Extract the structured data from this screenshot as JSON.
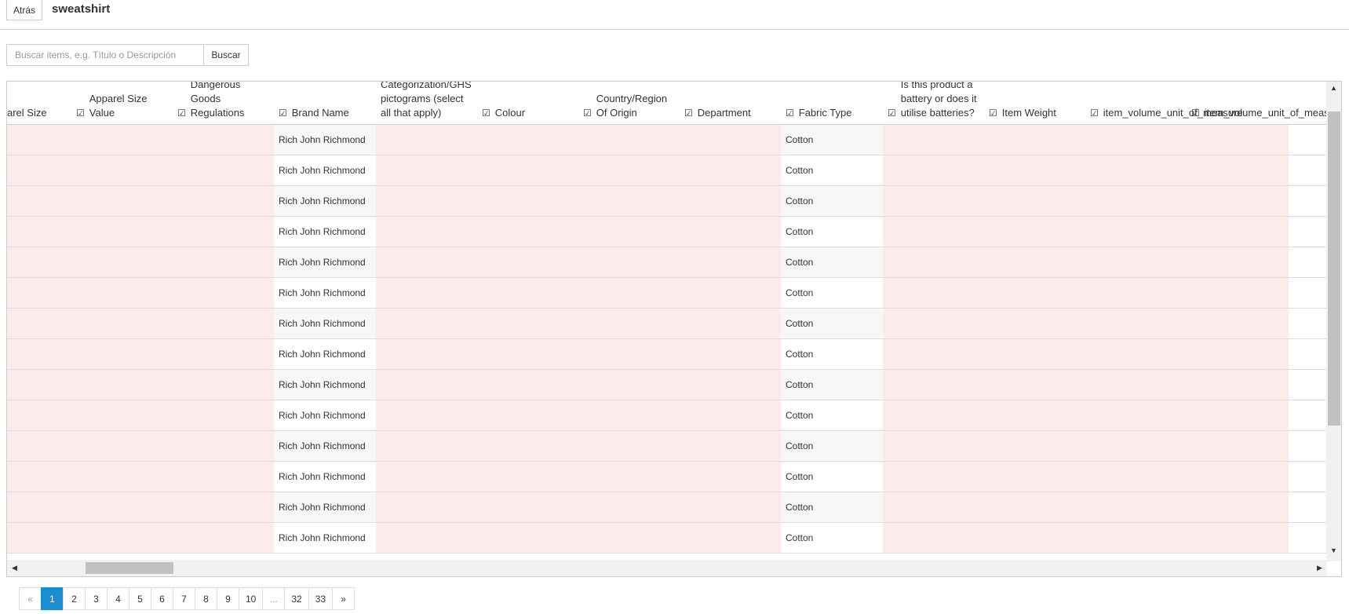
{
  "header": {
    "back_label": "Atrás",
    "title": "sweatshirt"
  },
  "search": {
    "placeholder": "Buscar items, e.g. Título o Descripción",
    "value": "",
    "button_label": "Buscar"
  },
  "table": {
    "columns": [
      {
        "label": "arel Size",
        "icon": false
      },
      {
        "label": "Apparel Size Value",
        "icon": true
      },
      {
        "label": "Applicable Dangerous Goods Regulations",
        "icon": true
      },
      {
        "label": "Brand Name",
        "icon": true
      },
      {
        "label": "Categorization/GHS pictograms (select all that apply)",
        "icon": false
      },
      {
        "label": "Colour",
        "icon": true
      },
      {
        "label": "Country/Region Of Origin",
        "icon": true
      },
      {
        "label": "Department",
        "icon": true
      },
      {
        "label": "Fabric Type",
        "icon": true
      },
      {
        "label": "Is this product a battery or does it utilise batteries?",
        "icon": true
      },
      {
        "label": "Item Weight",
        "icon": true
      },
      {
        "label": "item_volume_unit_of_measure",
        "icon": true
      },
      {
        "label": "item_volume_unit_of_measure",
        "icon": true
      }
    ],
    "rows": [
      {
        "brand": "Rich John Richmond",
        "fabric": "Cotton"
      },
      {
        "brand": "Rich John Richmond",
        "fabric": "Cotton"
      },
      {
        "brand": "Rich John Richmond",
        "fabric": "Cotton"
      },
      {
        "brand": "Rich John Richmond",
        "fabric": "Cotton"
      },
      {
        "brand": "Rich John Richmond",
        "fabric": "Cotton"
      },
      {
        "brand": "Rich John Richmond",
        "fabric": "Cotton"
      },
      {
        "brand": "Rich John Richmond",
        "fabric": "Cotton"
      },
      {
        "brand": "Rich John Richmond",
        "fabric": "Cotton"
      },
      {
        "brand": "Rich John Richmond",
        "fabric": "Cotton"
      },
      {
        "brand": "Rich John Richmond",
        "fabric": "Cotton"
      },
      {
        "brand": "Rich John Richmond",
        "fabric": "Cotton"
      },
      {
        "brand": "Rich John Richmond",
        "fabric": "Cotton"
      },
      {
        "brand": "Rich John Richmond",
        "fabric": "Cotton"
      },
      {
        "brand": "Rich John Richmond",
        "fabric": "Cotton"
      }
    ]
  },
  "pagination": {
    "pages": [
      "«",
      "1",
      "2",
      "3",
      "4",
      "5",
      "6",
      "7",
      "8",
      "9",
      "10",
      "...",
      "32",
      "33",
      "»"
    ],
    "active": "1"
  },
  "colors": {
    "invalid_cell": "#fdeaea",
    "active_page": "#1a8ed1"
  }
}
